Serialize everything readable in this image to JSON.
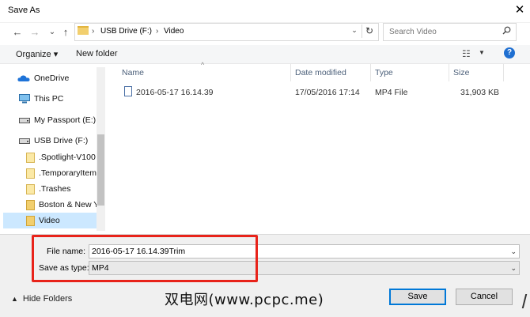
{
  "window": {
    "title": "Save As",
    "close_glyph": "✕"
  },
  "nav": {
    "back": "←",
    "forward": "→",
    "recent": "⌄",
    "up": "↑",
    "address": {
      "chevron": "›",
      "path": [
        "USB Drive (F:)",
        "Video"
      ],
      "dropdown": "⌄",
      "refresh": "↻"
    },
    "search": {
      "placeholder": "Search Video",
      "icon": "search-icon"
    }
  },
  "toolbar": {
    "organize": "Organize ▾",
    "new_folder": "New folder",
    "view": "☷",
    "view_dropdown": "▼",
    "help": "?"
  },
  "sidebar": {
    "items": [
      {
        "label": "OneDrive",
        "icon": "cloud-icon"
      },
      {
        "label": "This PC",
        "icon": "computer-icon"
      },
      {
        "label": "My Passport (E:)",
        "icon": "drive-icon"
      },
      {
        "label": "USB Drive (F:)",
        "icon": "usb-drive-icon"
      },
      {
        "label": ".Spotlight-V100",
        "icon": "folder-icon"
      },
      {
        "label": ".TemporaryItems",
        "icon": "folder-icon"
      },
      {
        "label": ".Trashes",
        "icon": "folder-icon"
      },
      {
        "label": "Boston & New Y",
        "icon": "folder-icon"
      },
      {
        "label": "Video",
        "icon": "folder-icon",
        "selected": true
      }
    ]
  },
  "columns": {
    "name": "Name",
    "date": "Date modified",
    "type": "Type",
    "size": "Size",
    "sort_caret": "^"
  },
  "files": [
    {
      "name": "2016-05-17 16.14.39",
      "date": "17/05/2016 17:14",
      "type": "MP4 File",
      "size": "31,903 KB"
    }
  ],
  "form": {
    "file_name_label": "File name:",
    "file_name_value": "2016-05-17 16.14.39Trim",
    "type_label": "Save as type:",
    "type_value": "MP4",
    "dropdown": "⌄"
  },
  "footer": {
    "hide_folders": "Hide Folders",
    "hide_caret": "▲",
    "save": "Save",
    "cancel": "Cancel",
    "watermark": "双电网(www.pcpc.me)"
  },
  "colors": {
    "highlight": "#e8231a",
    "selected": "#cce8ff",
    "accent": "#0078d7"
  }
}
